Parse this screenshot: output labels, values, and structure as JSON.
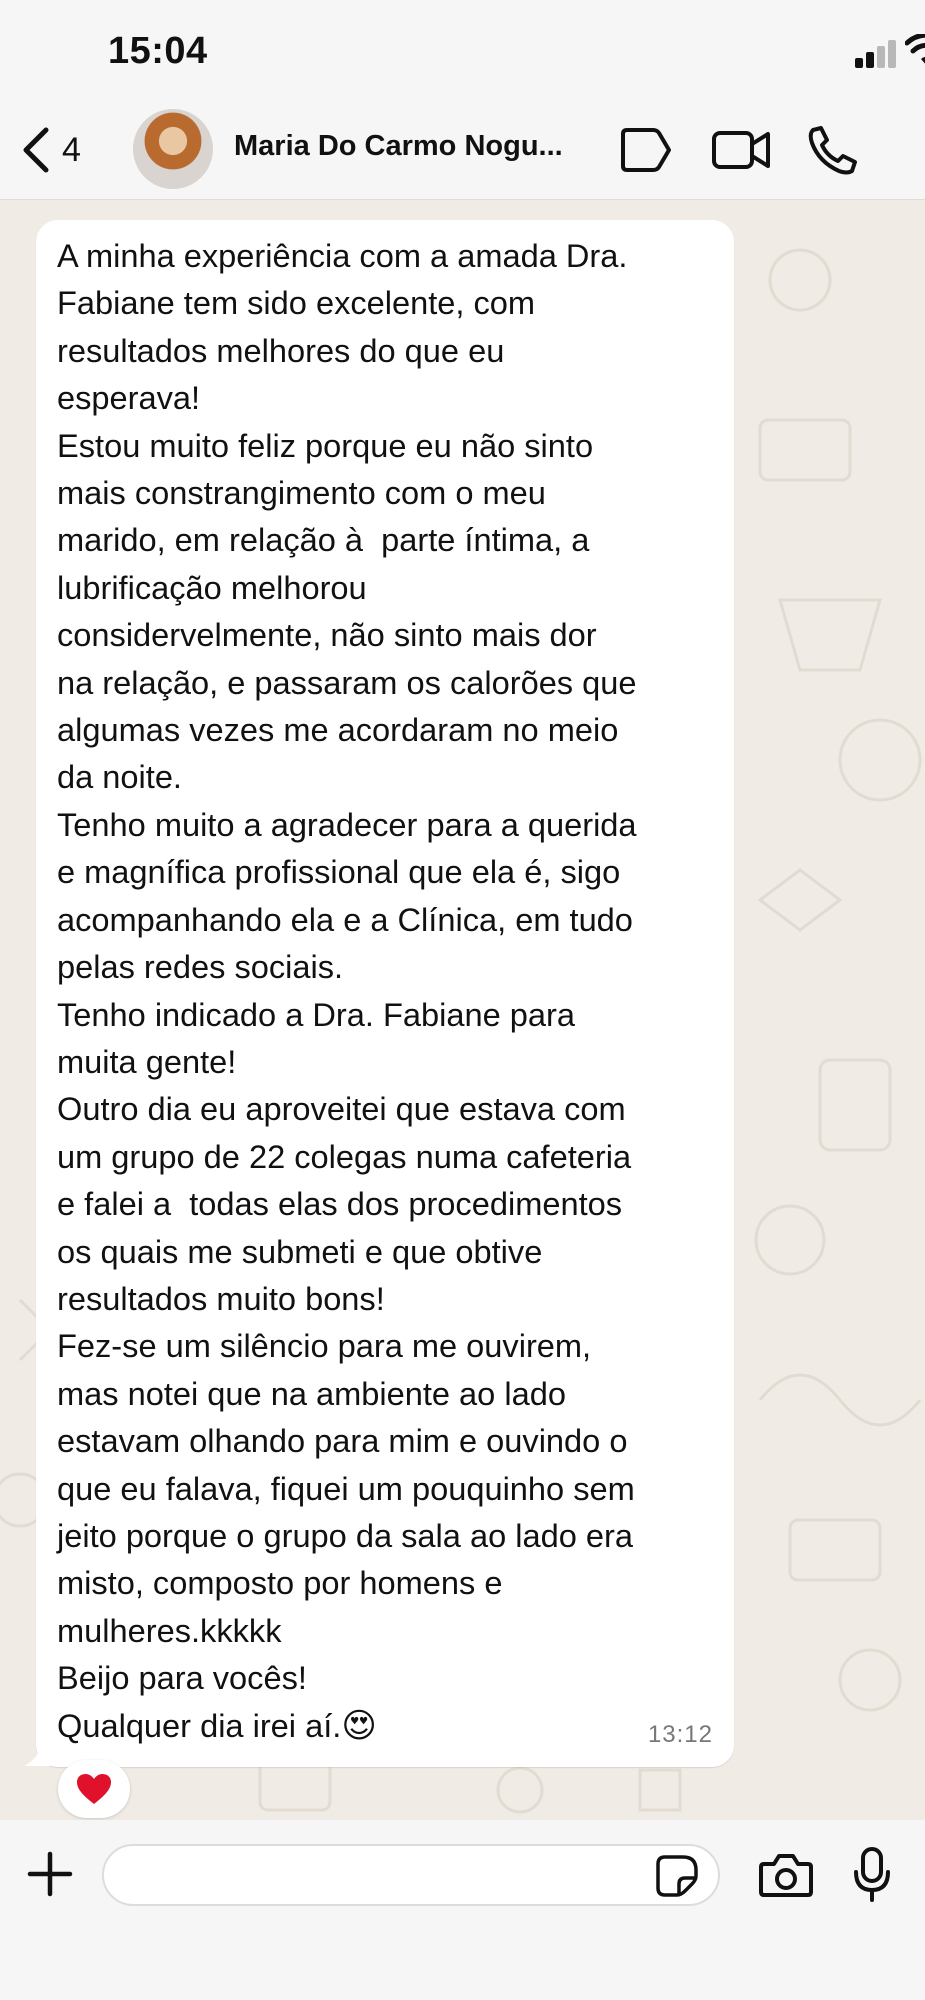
{
  "status_bar": {
    "time": "15:04"
  },
  "header": {
    "back_count": "4",
    "contact_name": "Maria Do Carmo Nogu..."
  },
  "message": {
    "text": "A minha experiência com a amada Dra.\nFabiane tem sido excelente, com\nresultados melhores do que eu\nesperava!\nEstou muito feliz porque eu não sinto\nmais constrangimento com o meu\nmarido, em relação à  parte íntima, a\nlubrificação melhorou\nconsidervelmente, não sinto mais dor\nna relação, e passaram os calorões que\nalgumas vezes me acordaram no meio\nda noite.\nTenho muito a agradecer para a querida\ne magnífica profissional que ela é, sigo\nacompanhando ela e a Clínica, em tudo\npelas redes sociais.\nTenho indicado a Dra. Fabiane para\nmuita gente!\nOutro dia eu aproveitei que estava com\num grupo de 22 colegas numa cafeteria\ne falei a  todas elas dos procedimentos\nos quais me submeti e que obtive\nresultados muito bons!\nFez-se um silêncio para me ouvirem,\nmas notei que na ambiente ao lado\nestavam olhando para mim e ouvindo o\nque eu falava, fiquei um pouquinho sem\njeito porque o grupo da sala ao lado era\nmisto, composto por homens e\nmulheres.kkkkk\nBeijo para vocês!\nQualquer dia irei aí.",
    "emoji": "😍",
    "time": "13:12",
    "reaction": "heart"
  },
  "composer": {
    "value": "",
    "placeholder": ""
  },
  "icons": {
    "back": "chevron-left-icon",
    "label": "label-tag-icon",
    "video": "video-camera-icon",
    "call": "phone-icon",
    "attach": "plus-icon",
    "sticker": "sticker-icon",
    "camera": "camera-icon",
    "mic": "microphone-icon"
  },
  "colors": {
    "header_bg": "#f6f6f6",
    "chat_bg": "#f0ebe4",
    "bubble_bg": "#ffffff",
    "text": "#111111",
    "time_text": "#777777",
    "reaction_heart": "#e0112b"
  }
}
